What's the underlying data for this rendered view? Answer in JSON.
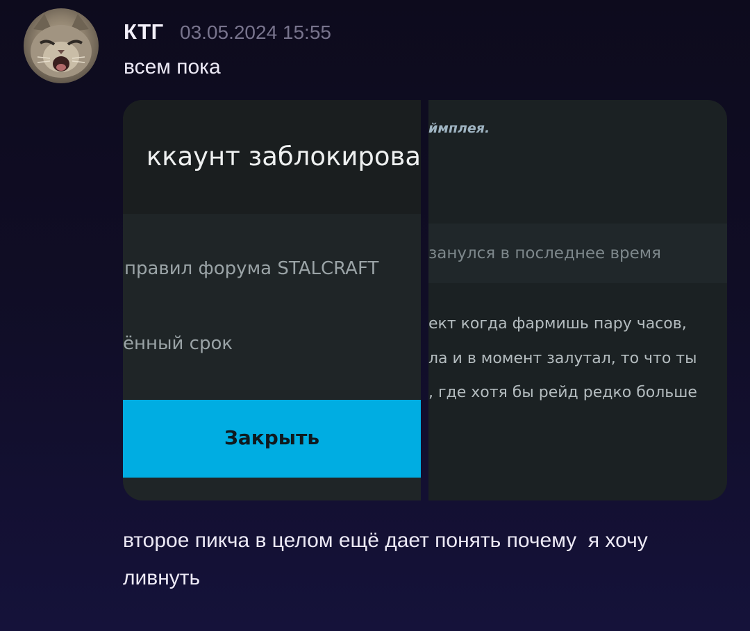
{
  "message": {
    "author": "КТГ",
    "timestamp": "03.05.2024 15:55",
    "text": "всем пока",
    "followup_text": "второе пикча в целом ещё дает понять почему  я хочу ливнуть"
  },
  "attachments": [
    {
      "title": "ккаунт заблокирова",
      "reason": "правил форума STALCRAFT",
      "term": "ённый срок",
      "button_label": "Закрыть"
    },
    {
      "top_text": "ймплея.",
      "band_text": "занулся в последнее время",
      "lines": [
        "ект когда фармишь пару часов,",
        "ла и в момент залутал, то что ты",
        ", где хотя бы рейд редко больше"
      ]
    }
  ],
  "colors": {
    "background": "#100d25",
    "accent_button": "#00ade2",
    "author_text": "#f3f0fa",
    "timestamp_text": "#78748d"
  }
}
